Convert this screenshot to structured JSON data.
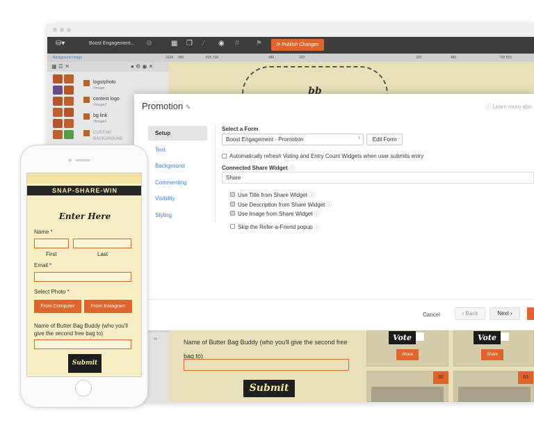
{
  "browser": {
    "toolbar": {
      "page_select": "Boost Engagement...",
      "publish_label": "Publish Changes"
    },
    "ruler_labels": [
      "1024",
      "960",
      "815 768",
      "480",
      "320",
      "320",
      "480",
      "768 815"
    ],
    "left_panel": {
      "title": "Background Image",
      "assets": [
        {
          "name": "logo/photo",
          "tag": "#image"
        },
        {
          "name": "contest logo",
          "tag": "#image2"
        },
        {
          "name": "bg link",
          "tag": "#image4"
        },
        {
          "name": "CUSTOM BACKGROUND",
          "tag": ""
        }
      ]
    },
    "canvas_logo": "bb"
  },
  "modal": {
    "title": "Promotion",
    "learn_more": "Learn more abo",
    "tabs": [
      "Setup",
      "Text",
      "Background",
      "Commenting",
      "Visibility",
      "Styling"
    ],
    "active_tab": "Setup",
    "select_form_label": "Select a Form",
    "form_value": "Boost Engagement - Promotion",
    "edit_form": "Edit Form",
    "auto_refresh": "Automatically refresh Voting and Entry Count Widgets when user submits entry",
    "connected_label": "Connected Share Widget",
    "share_value": "Share",
    "options": [
      {
        "label": "Use Title from Share Widget",
        "checked": true
      },
      {
        "label": "Use Description from Share Widget",
        "checked": true
      },
      {
        "label": "Use Image from Share Widget",
        "checked": true
      },
      {
        "label": "Skip the Refer-a-Friend popup",
        "checked": false
      }
    ],
    "cancel": "Cancel",
    "back": "Back",
    "next": "Next"
  },
  "canvas_below": {
    "buddy_question": "Name of Butter Bag Buddy (who you'll give the second free bag to)",
    "submit": "Submit",
    "entries": [
      {
        "vote": "Vote",
        "share": "Share",
        "count": "32"
      },
      {
        "vote": "Vote",
        "share": "Share",
        "count": "63"
      }
    ]
  },
  "phone": {
    "banner": "SNAP-SHARE-WIN",
    "enter_here": "Enter Here",
    "name_label": "Name *",
    "first": "First",
    "last": "Last",
    "email_label": "Email *",
    "photo_label": "Select Photo *",
    "from_computer": "From Computer",
    "from_instagram": "From Instagram",
    "buddy_question": "Name of Butter Bag Buddy (who you'll give the second free bag to)",
    "submit": "Submit"
  },
  "colors": {
    "accent": "#e0652c",
    "toolbar": "#3d3d3d",
    "canvas": "#e9dfb8",
    "link": "#3b7dc4"
  }
}
